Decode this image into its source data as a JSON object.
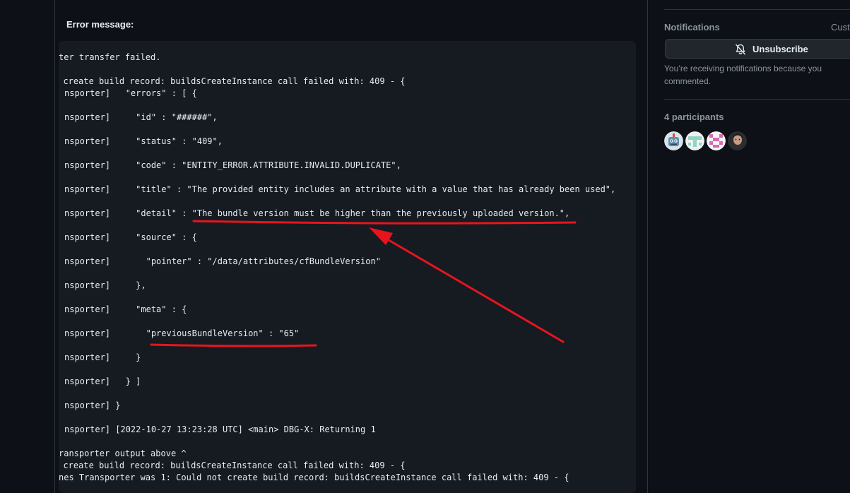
{
  "comment": {
    "error_label": "Error message:",
    "code_lines": [
      "ter transfer failed.",
      ": create build record: buildsCreateInstance call failed with: 409 - {",
      "nsporter]   \"errors\" : [ {",
      "nsporter]     \"id\" : \"######\",",
      "nsporter]     \"status\" : \"409\",",
      "nsporter]     \"code\" : \"ENTITY_ERROR.ATTRIBUTE.INVALID.DUPLICATE\",",
      "nsporter]     \"title\" : \"The provided entity includes an attribute with a value that has already been used\",",
      "nsporter]     \"detail\" : \"The bundle version must be higher than the previously uploaded version.\",",
      "nsporter]     \"source\" : {",
      "nsporter]       \"pointer\" : \"/data/attributes/cfBundleVersion\"",
      "nsporter]     },",
      "nsporter]     \"meta\" : {",
      "nsporter]       \"previousBundleVersion\" : \"65\"",
      "nsporter]     }",
      "nsporter]   } ]",
      "nsporter] }",
      "nsporter] [2022-10-27 13:23:28 UTC] <main> DBG-X: Returning 1",
      "ransporter output above ^",
      ": create build record: buildsCreateInstance call failed with: 409 - {",
      "nes Transporter was 1: Could not create build record: buildsCreateInstance call failed with: 409 - {"
    ]
  },
  "sidebar": {
    "notifications_heading": "Notifications",
    "customize_label": "Customize",
    "unsubscribe_label": "Unsubscribe",
    "notify_text": "You’re receiving notifications because you commented.",
    "participants_heading": "4 participants"
  },
  "colors": {
    "background": "#0d1117",
    "code_background": "#161b22",
    "annotation_red": "#e8141d"
  }
}
